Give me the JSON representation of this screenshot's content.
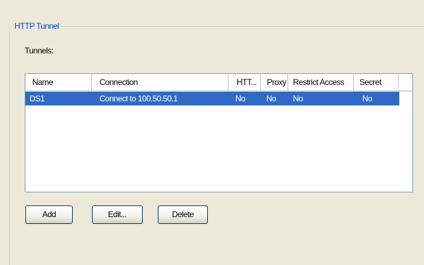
{
  "group": {
    "title": "HTTP Tunnel"
  },
  "tunnels": {
    "label": "Tunnels:",
    "columns": [
      "Name",
      "Connection",
      "HTT...",
      "Proxy",
      "Restrict Access",
      "Secret"
    ],
    "rows": [
      {
        "name": "DS1",
        "connection": "Connect to 100.50.50.1",
        "http": "No",
        "proxy": "No",
        "restrict_access": "No",
        "secret": "No",
        "selected": true
      }
    ]
  },
  "buttons": {
    "add": "Add",
    "edit": "Edit...",
    "delete": "Delete"
  },
  "colors": {
    "background": "#ECE9D8",
    "group_title": "#0046D5",
    "selection": "#316AC5",
    "list_border": "#7F9DB9"
  }
}
